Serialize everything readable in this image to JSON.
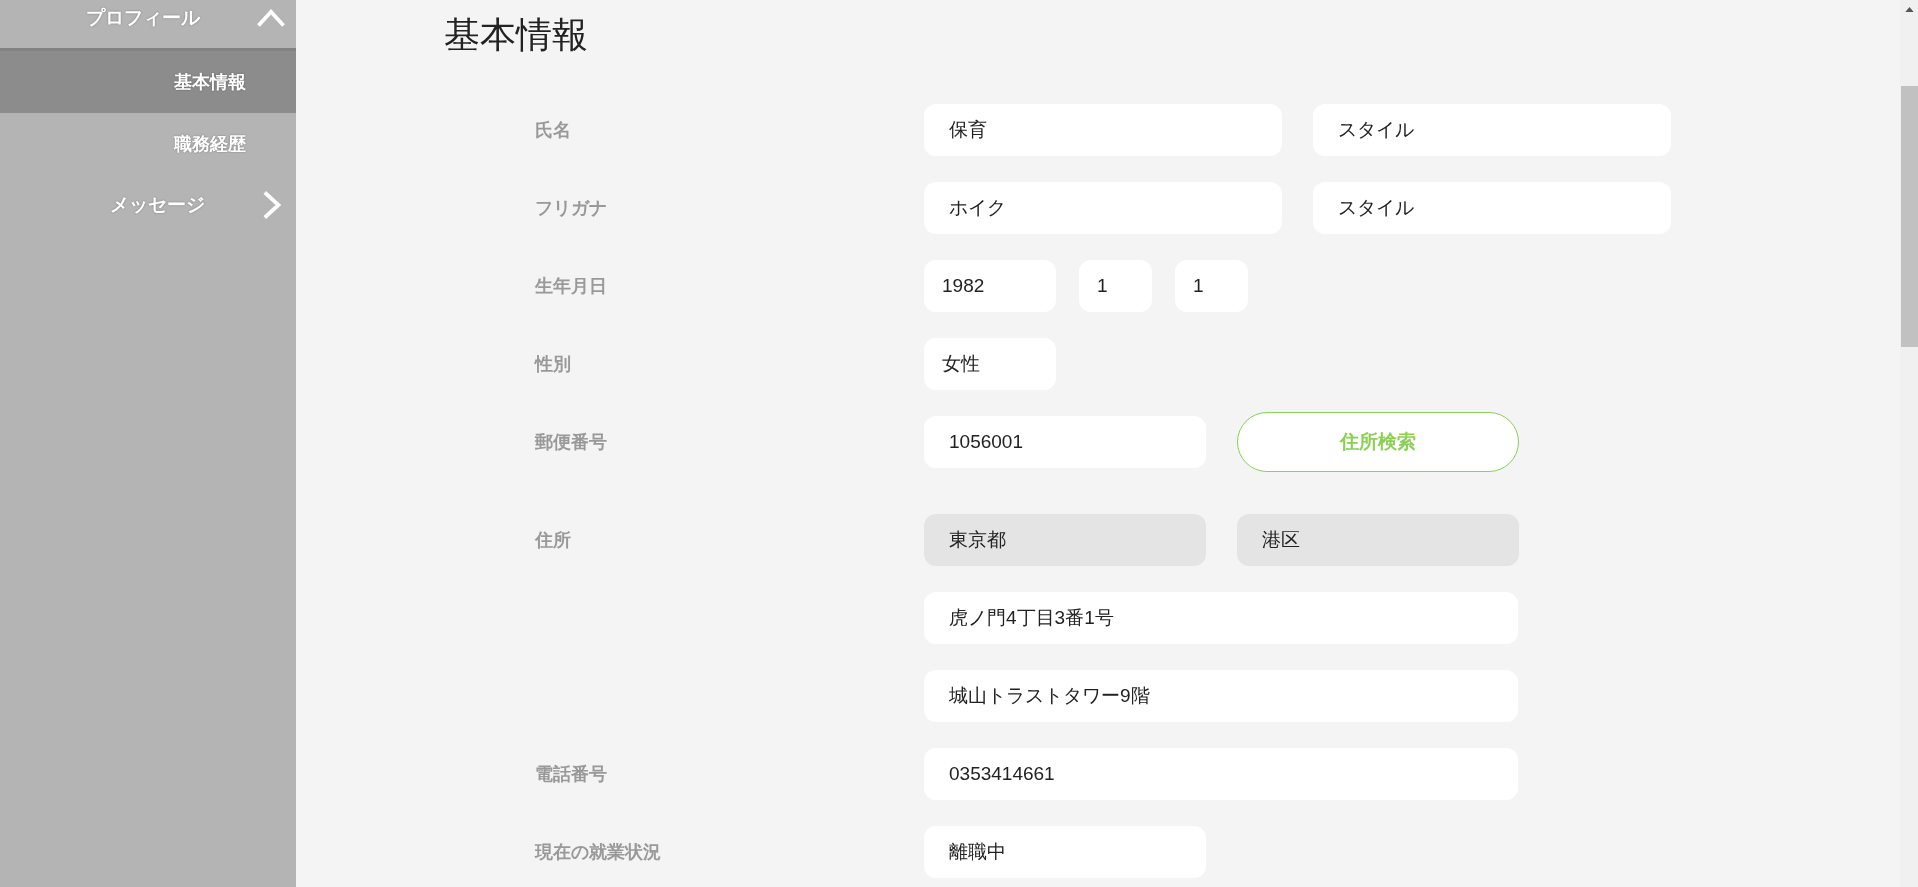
{
  "sidebar": {
    "items": [
      {
        "label": "プロフィール",
        "expanded": true,
        "children": [
          {
            "label": "基本情報",
            "selected": true
          },
          {
            "label": "職務経歴",
            "selected": false
          }
        ]
      },
      {
        "label": "メッセージ",
        "expanded": false
      }
    ]
  },
  "title": "基本情報",
  "rows": [
    {
      "label": "氏名",
      "fields": [
        {
          "kind": "large",
          "value": "保育",
          "readonly": false
        },
        {
          "kind": "large",
          "value": "スタイル",
          "readonly": false
        }
      ]
    },
    {
      "label": "フリガナ",
      "fields": [
        {
          "kind": "large",
          "value": "ホイク",
          "readonly": false
        },
        {
          "kind": "large",
          "value": "スタイル",
          "readonly": false
        }
      ]
    },
    {
      "label": "生年月日",
      "fields": [
        {
          "kind": "small",
          "value": "1982",
          "readonly": false
        },
        {
          "kind": "tiny",
          "value": "1",
          "readonly": false
        },
        {
          "kind": "tiny",
          "value": "1",
          "readonly": false
        }
      ]
    },
    {
      "label": "性別",
      "fields": [
        {
          "kind": "small",
          "value": "女性",
          "readonly": false
        }
      ]
    },
    {
      "label": "郵便番号",
      "fields": [
        {
          "kind": "medium",
          "value": "1056001",
          "readonly": false
        },
        {
          "kind": "button",
          "value": "住所検索"
        }
      ]
    },
    {
      "label": "住所",
      "fields": [
        {
          "kind": "medium",
          "value": "東京都",
          "readonly": true
        },
        {
          "kind": "medium",
          "value": "港区",
          "readonly": true
        }
      ]
    },
    {
      "fields": [
        {
          "kind": "wide",
          "value": "虎ノ門4丁目3番1号",
          "readonly": false
        }
      ]
    },
    {
      "fields": [
        {
          "kind": "wide",
          "value": "城山トラストタワー9階",
          "readonly": false
        }
      ]
    },
    {
      "label": "電話番号",
      "fields": [
        {
          "kind": "wide",
          "value": "0353414661",
          "readonly": false
        }
      ]
    },
    {
      "label": "現在の就業状況",
      "fields": [
        {
          "kind": "medium",
          "value": "離職中",
          "readonly": false
        }
      ]
    }
  ]
}
